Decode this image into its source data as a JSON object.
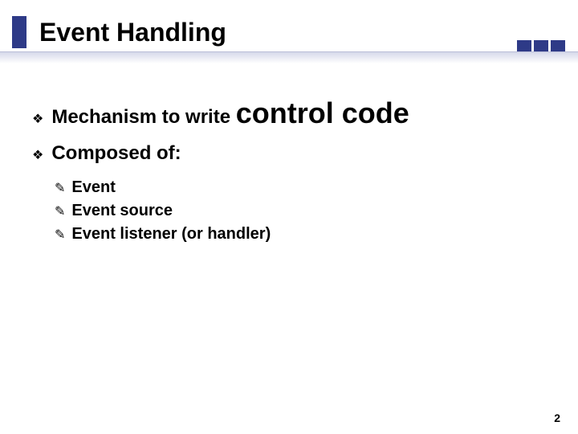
{
  "slide": {
    "title": "Event Handling",
    "bullets": [
      {
        "prefix": "Mechanism to write ",
        "emphasis": "control code"
      },
      {
        "prefix": "Composed of:",
        "emphasis": ""
      }
    ],
    "subbullets": [
      "Event",
      "Event source",
      "Event listener (or handler)"
    ],
    "page_number": "2"
  },
  "glyphs": {
    "diamond": "❖",
    "penpoint": "✎"
  },
  "colors": {
    "accent": "#2e3a87"
  }
}
